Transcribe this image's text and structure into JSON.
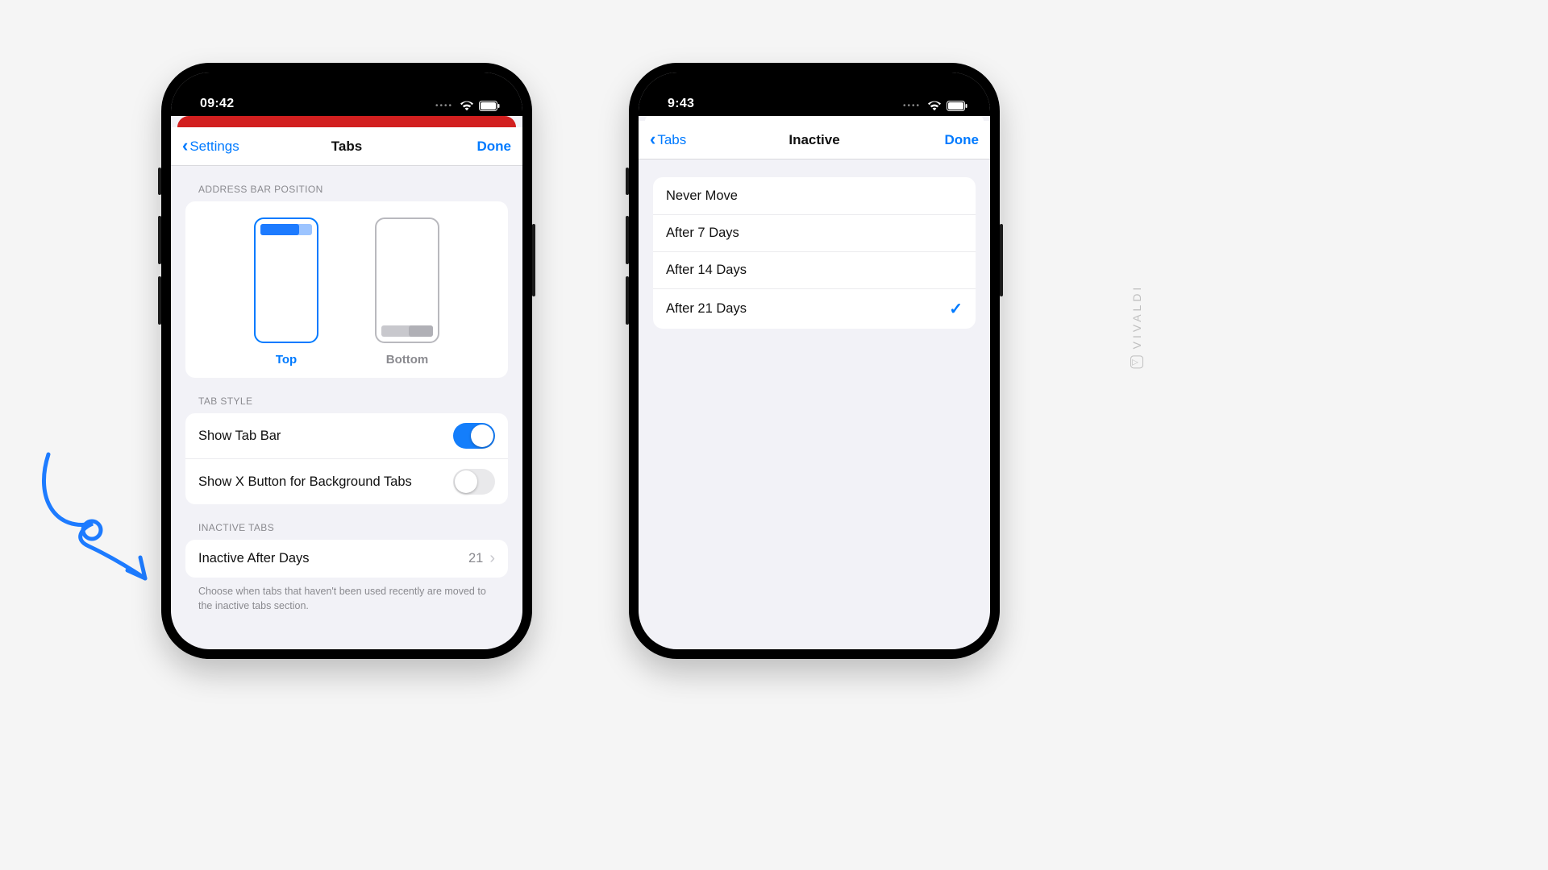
{
  "brand": {
    "name": "VIVALDI",
    "accent": "#007aff",
    "danger": "#d21f1f"
  },
  "arrow_color": "#1d7bff",
  "phone1": {
    "status_time": "09:42",
    "nav_back": "Settings",
    "nav_title": "Tabs",
    "nav_done": "Done",
    "section_address": "ADDRESS BAR POSITION",
    "address_options": {
      "top": "Top",
      "bottom": "Bottom",
      "selected": "top"
    },
    "section_tabstyle": "TAB STYLE",
    "tabstyle": {
      "show_tab_bar_label": "Show Tab Bar",
      "show_tab_bar_on": true,
      "show_x_label": "Show X Button for Background Tabs",
      "show_x_on": false
    },
    "section_inactive": "INACTIVE TABS",
    "inactive_row_label": "Inactive After Days",
    "inactive_row_value": "21",
    "inactive_footer": "Choose when tabs that haven't been used recently are moved to the inactive tabs section."
  },
  "phone2": {
    "status_time": "9:43",
    "nav_back": "Tabs",
    "nav_title": "Inactive",
    "nav_done": "Done",
    "options": [
      {
        "label": "Never Move",
        "selected": false
      },
      {
        "label": "After 7 Days",
        "selected": false
      },
      {
        "label": "After 14 Days",
        "selected": false
      },
      {
        "label": "After 21 Days",
        "selected": true
      }
    ]
  }
}
